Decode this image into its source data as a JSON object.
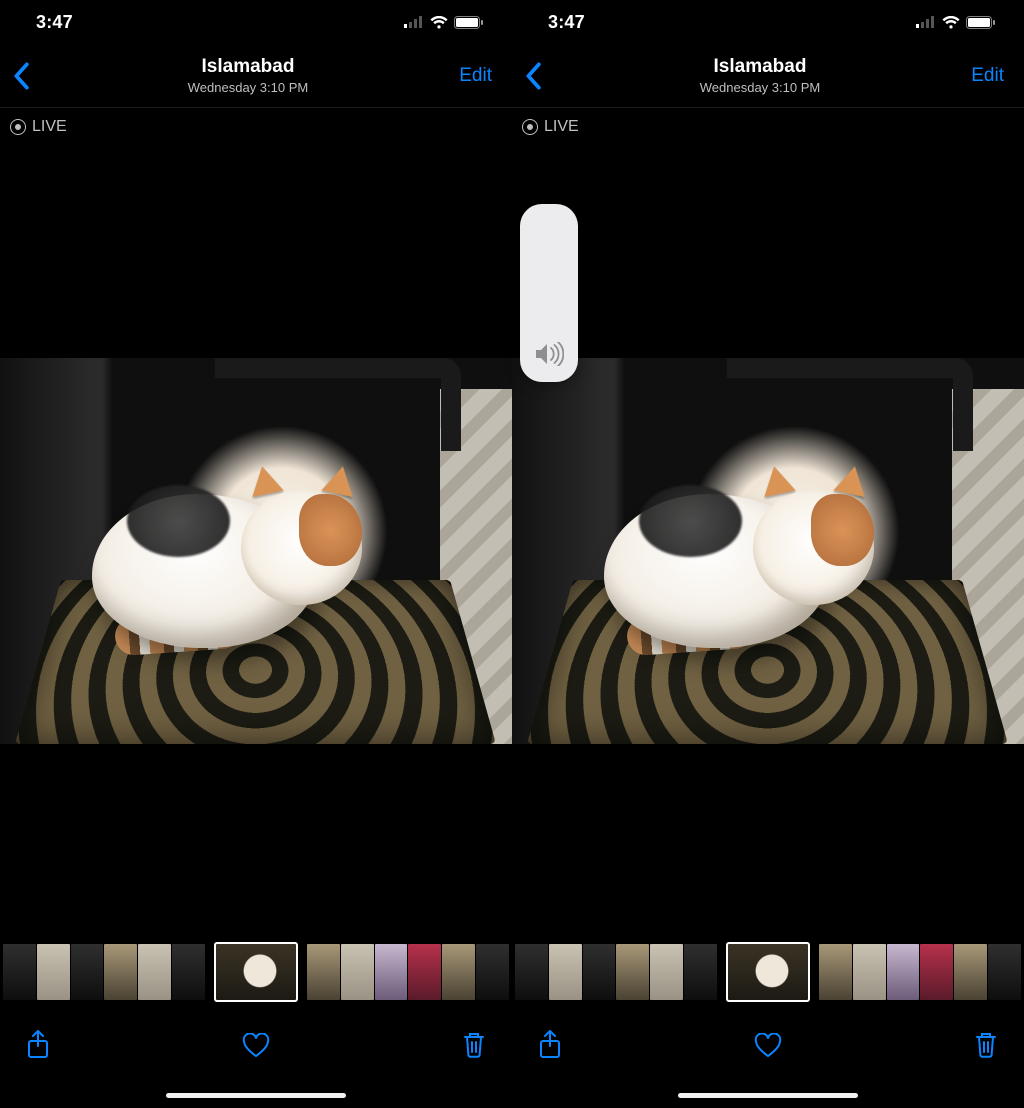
{
  "status": {
    "time": "3:47"
  },
  "nav": {
    "title": "Islamabad",
    "subtitle": "Wednesday  3:10 PM",
    "edit": "Edit"
  },
  "badge": {
    "live": "LIVE"
  },
  "colors": {
    "accent": "#0a84ff"
  }
}
